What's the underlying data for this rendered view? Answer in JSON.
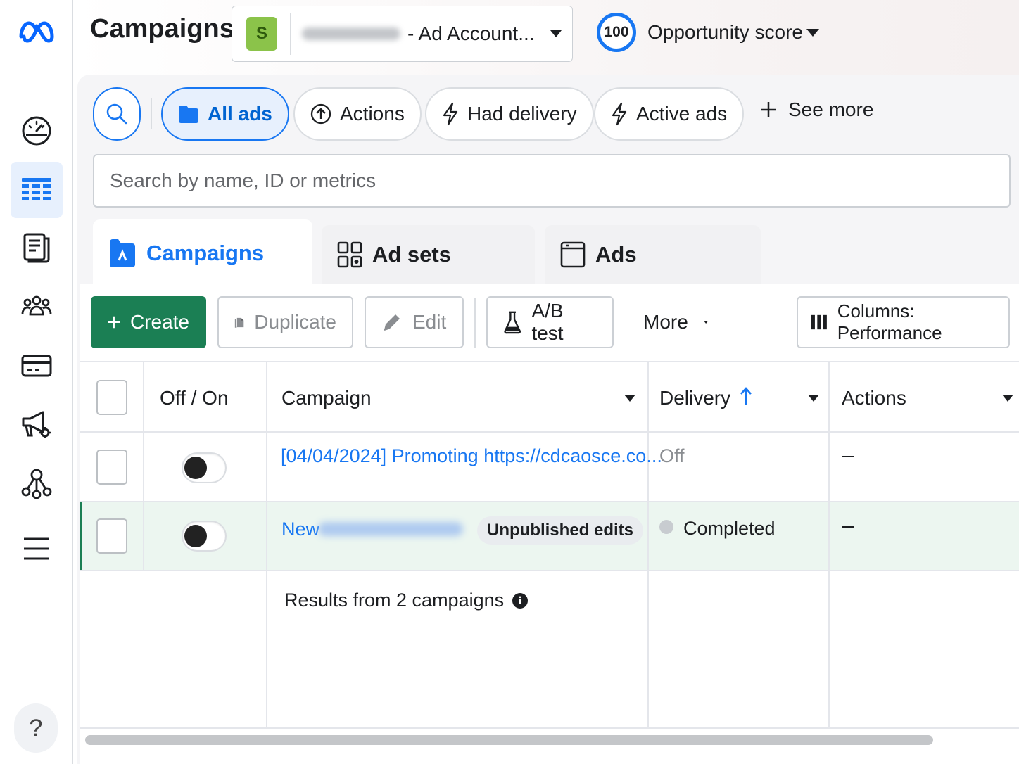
{
  "header": {
    "title": "Campaigns",
    "account": {
      "badge": "S",
      "name": "- Ad Account..."
    },
    "opportunity": {
      "score": "100",
      "label": "Opportunity score"
    }
  },
  "filters": {
    "chips": [
      {
        "label": "All ads",
        "icon": "folder-icon",
        "selected": true
      },
      {
        "label": "Actions",
        "icon": "arrow-up-circle-icon"
      },
      {
        "label": "Had delivery",
        "icon": "lightning-icon"
      },
      {
        "label": "Active ads",
        "icon": "lightning-icon"
      }
    ],
    "see_more": "See more",
    "search_placeholder": "Search by name, ID or metrics"
  },
  "tabs": [
    {
      "label": "Campaigns",
      "icon": "campaign-icon",
      "active": true
    },
    {
      "label": "Ad sets",
      "icon": "grid-icon"
    },
    {
      "label": "Ads",
      "icon": "ad-icon"
    }
  ],
  "toolbar": {
    "create": "Create",
    "duplicate": "Duplicate",
    "edit": "Edit",
    "ab_test": "A/B test",
    "more": "More",
    "columns": "Columns: Performance"
  },
  "table": {
    "columns": [
      "Off / On",
      "Campaign",
      "Delivery",
      "Actions"
    ],
    "rows": [
      {
        "toggle": "off",
        "campaign": "[04/04/2024] Promoting https://cdcaosce.co...",
        "delivery": "Off",
        "actions": "—"
      },
      {
        "toggle": "off",
        "campaign": "New",
        "badge": "Unpublished edits",
        "delivery": "Completed",
        "actions": "—"
      }
    ],
    "footer": "Results from 2 campaigns"
  },
  "colors": {
    "accent": "#1877f2",
    "create_button": "#1b7f54",
    "highlight_row": "#ecf6f0"
  },
  "nav": {
    "items": [
      "dashboard-gauge-icon",
      "campaign-table-icon",
      "pages-icon",
      "audiences-icon",
      "billing-card-icon",
      "ad-settings-icon",
      "business-network-icon",
      "all-tools-menu-icon"
    ],
    "help": "?"
  }
}
